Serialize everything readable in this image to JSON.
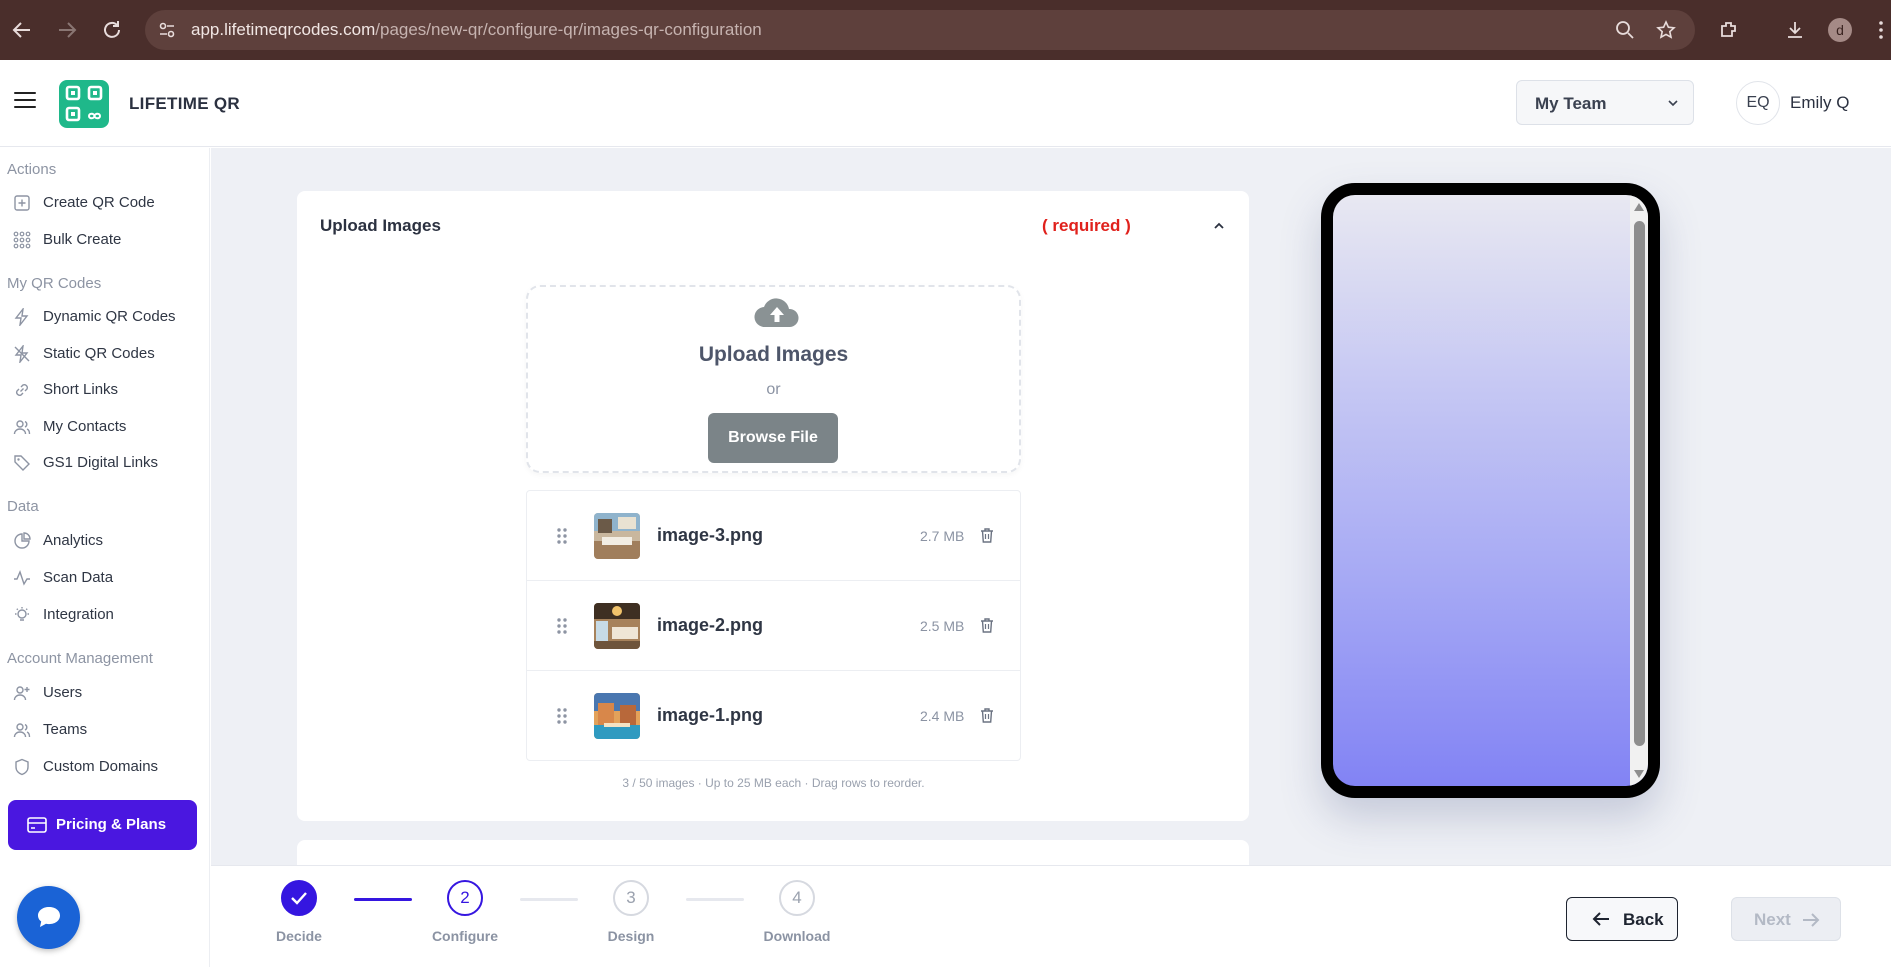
{
  "browser": {
    "url_host": "app.lifetimeqrcodes.com",
    "url_path": "/pages/new-qr/configure-qr/images-qr-configuration",
    "profile_initial": "d"
  },
  "header": {
    "brand": "LIFETIME QR",
    "team_select": "My Team",
    "user_initials": "EQ",
    "user_name": "Emily Q"
  },
  "sidebar": {
    "sections": {
      "actions": "Actions",
      "my_qr_codes": "My QR Codes",
      "data": "Data",
      "account": "Account Management"
    },
    "items": [
      {
        "label": "Create QR Code",
        "icon": "plus-square-icon"
      },
      {
        "label": "Bulk Create",
        "icon": "grid-dots-icon"
      },
      {
        "label": "Dynamic QR Codes",
        "icon": "lightning-icon"
      },
      {
        "label": "Static QR Codes",
        "icon": "lightning-off-icon"
      },
      {
        "label": "Short Links",
        "icon": "link-icon"
      },
      {
        "label": "My Contacts",
        "icon": "users-icon"
      },
      {
        "label": "GS1 Digital Links",
        "icon": "tag-icon"
      },
      {
        "label": "Analytics",
        "icon": "pie-chart-icon"
      },
      {
        "label": "Scan Data",
        "icon": "activity-icon"
      },
      {
        "label": "Integration",
        "icon": "bulb-icon"
      },
      {
        "label": "Users",
        "icon": "user-plus-icon"
      },
      {
        "label": "Teams",
        "icon": "users-icon"
      },
      {
        "label": "Custom Domains",
        "icon": "shield-icon"
      }
    ],
    "pricing": "Pricing & Plans"
  },
  "upload": {
    "title": "Upload Images",
    "required": "( required )",
    "dropzone_title": "Upload Images",
    "dropzone_or": "or",
    "browse": "Browse File",
    "files": [
      {
        "name": "image-3.png",
        "size": "2.7 MB"
      },
      {
        "name": "image-2.png",
        "size": "2.5 MB"
      },
      {
        "name": "image-1.png",
        "size": "2.4 MB"
      }
    ],
    "note": "3 / 50 images · Up to 25 MB each · Drag rows to reorder."
  },
  "stepper": {
    "steps": [
      {
        "num": "",
        "label": "Decide",
        "state": "done"
      },
      {
        "num": "2",
        "label": "Configure",
        "state": "active"
      },
      {
        "num": "3",
        "label": "Design",
        "state": "pending"
      },
      {
        "num": "4",
        "label": "Download",
        "state": "pending"
      }
    ],
    "back": "Back",
    "next": "Next"
  },
  "colors": {
    "accent": "#3516e0",
    "brand_green": "#1fb88a",
    "required_red": "#e0211c",
    "pricing_purple": "#4a17e0",
    "chrome_bg": "#4a2e2b"
  }
}
